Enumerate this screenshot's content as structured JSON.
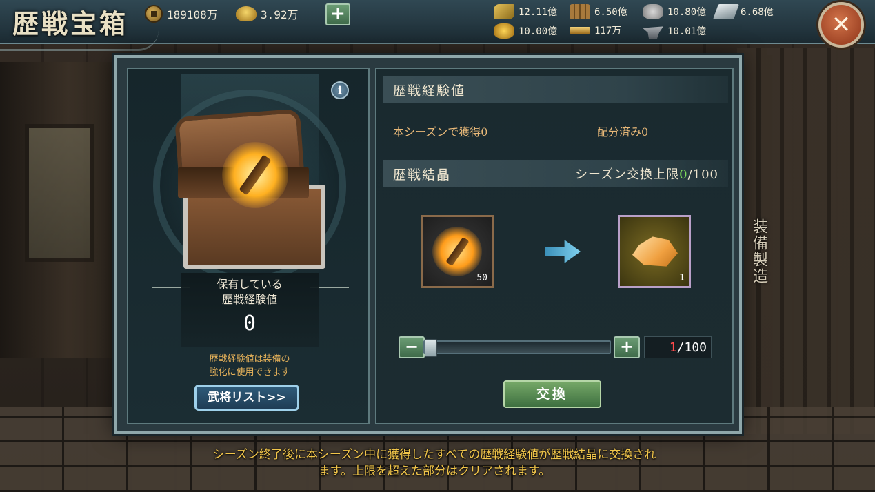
{
  "header": {
    "title": "歴戦宝箱",
    "currency": {
      "copper_value": "189108万",
      "ingot_value": "3.92万",
      "add_label": "+"
    },
    "resources": [
      {
        "icon": "grain-icon",
        "value": "12.11億"
      },
      {
        "icon": "wood-icon",
        "value": "6.50億"
      },
      {
        "icon": "stone-icon",
        "value": "10.80億"
      },
      {
        "icon": "iron-icon",
        "value": "6.68億"
      },
      {
        "icon": "gold-icon",
        "value": "10.00億"
      },
      {
        "icon": "gold-bar-icon",
        "value": "117万"
      },
      {
        "icon": "anvil-icon",
        "value": "10.01億"
      }
    ],
    "close_label": "✕"
  },
  "left": {
    "info_label": "i",
    "held_label_line1": "保有している",
    "held_label_line2": "歴戦経験値",
    "held_value": "0",
    "note_line1": "歴戦経験値は装備の",
    "note_line2": "強化に使用できます",
    "list_button": "武将リスト>>"
  },
  "right": {
    "exp_header": "歴戦経験値",
    "season_gain": "本シーズンで獲得0",
    "allocated": "配分済み0",
    "crystal_header": "歴戦結晶",
    "season_limit_prefix": "シーズン交換上限",
    "season_limit_current": "0",
    "season_limit_suffix": "/100",
    "input_item_qty": "50",
    "output_item_qty": "1",
    "minus_label": "−",
    "plus_label": "+",
    "quantity_current": "1",
    "quantity_max": "/100",
    "exchange_button": "交換"
  },
  "side_tab": "装備製造",
  "footer": {
    "line1": "シーズン終了後に本シーズン中に獲得したすべての歴戦経験値が歴戦結晶に交換され",
    "line2": "ます。上限を超えた部分はクリアされます。"
  },
  "colors": {
    "accent_green": "#7edc5a",
    "quantity_red": "#ff4a4a",
    "note_gold": "#e6b25a",
    "footer_gold": "#f2c64a"
  }
}
